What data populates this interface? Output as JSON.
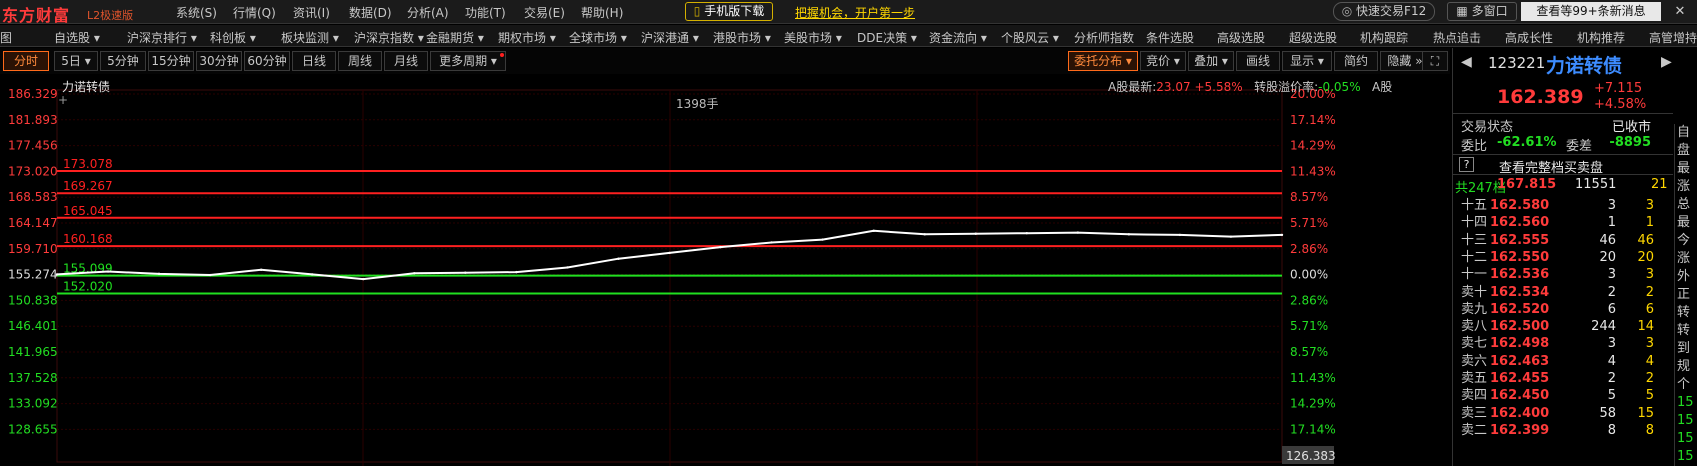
{
  "app": {
    "logo": "东方财富",
    "edition": "L2极速版",
    "menus": [
      "系统(S)",
      "行情(Q)",
      "资讯(I)",
      "数据(D)",
      "分析(A)",
      "功能(T)",
      "交易(E)",
      "帮助(H)"
    ],
    "mobile_download": "手机版下载",
    "promo": "把握机会，开户第一步",
    "fast_trade": "快速交易F12",
    "multi_window": "多窗口",
    "new_messages": "查看等99+条新消息",
    "close_glyph": "✕"
  },
  "nav": [
    "图",
    "自选股 ▾",
    "沪深京排行 ▾",
    "科创板 ▾",
    "板块监测 ▾",
    "沪深京指数 ▾",
    "金融期货 ▾",
    "期权市场 ▾",
    "全球市场 ▾",
    "沪深港通 ▾",
    "港股市场 ▾",
    "美股市场 ▾",
    "DDE决策 ▾",
    "资金流向 ▾",
    "个股风云 ▾",
    "分析师指数",
    "条件选股",
    "高级选股",
    "超级选股",
    "机构跟踪",
    "热点追击",
    "高成长性",
    "机构推荐",
    "高管增持"
  ],
  "periods": [
    "分时",
    "5日 ▾",
    "5分钟",
    "15分钟",
    "30分钟",
    "60分钟",
    "日线",
    "周线",
    "月线",
    "更多周期 ▾"
  ],
  "active_period": "分时",
  "right_tools": [
    "委托分布 ▾",
    "竞价 ▾",
    "叠加 ▾",
    "画线",
    "显示 ▾",
    "简约",
    "隐藏 »",
    "⛶"
  ],
  "chart": {
    "name": "力诺转债",
    "a_share_label": "A股最新:",
    "a_share_price": "23.07",
    "a_share_change": "+5.58%",
    "premium_label": "转股溢价率:",
    "premium": "-0.05%",
    "premium_suffix": "A股",
    "volume_note": "1398手",
    "left_axis": [
      "186.329",
      "181.893",
      "177.456",
      "173.020",
      "168.583",
      "164.147",
      "159.710",
      "155.274",
      "150.838",
      "146.401",
      "141.965",
      "137.528",
      "133.092",
      "128.655"
    ],
    "right_axis": [
      "20.00%",
      "17.14%",
      "14.29%",
      "11.43%",
      "8.57%",
      "5.71%",
      "2.86%",
      "0.00%",
      "2.86%",
      "5.71%",
      "8.57%",
      "11.43%",
      "14.29%",
      "17.14%"
    ],
    "bottom_right_value": "126.383",
    "price_lines": [
      {
        "label": "173.078",
        "color": "#ff2020"
      },
      {
        "label": "169.267",
        "color": "#ff2020"
      },
      {
        "label": "165.045",
        "color": "#ff2020"
      },
      {
        "label": "160.168",
        "color": "#ff2020"
      },
      {
        "label": "155.099",
        "color": "#20e020"
      },
      {
        "label": "152.020",
        "color": "#20e020"
      }
    ],
    "colors": {
      "up": "#ff3b3b",
      "down": "#22dd22",
      "grid": "#2a0000",
      "line": "#ffffff",
      "avg": "#333333"
    }
  },
  "chart_data": {
    "type": "line",
    "title": "力诺转债",
    "x": [
      0,
      10,
      20,
      30,
      40,
      50,
      60,
      70,
      80,
      90,
      100,
      110,
      120,
      130,
      140,
      150,
      160,
      170,
      180,
      190,
      200,
      210,
      220,
      230,
      240
    ],
    "values": [
      155.3,
      155.8,
      155.4,
      155.2,
      156.1,
      155.3,
      154.5,
      155.5,
      155.6,
      155.7,
      156.5,
      158.0,
      159.0,
      160.0,
      160.8,
      161.3,
      162.8,
      162.2,
      162.3,
      162.4,
      162.5,
      162.2,
      162.1,
      161.8,
      162.1
    ],
    "ylim": [
      128.655,
      186.329
    ],
    "grid": true
  },
  "panel": {
    "code": "123221",
    "name": "力诺转债",
    "price": "162.389",
    "change": "+7.115",
    "change_pct": "+4.58%",
    "status_label": "交易状态",
    "status_value": "已收市",
    "webi_label": "委比",
    "webi_value": "-62.61%",
    "weicha_label": "委差",
    "weicha_value": "-8895",
    "view_full": "查看完整档买卖盘",
    "help_glyph": "?",
    "total_label": "共247档",
    "total_price": "167.815",
    "total_vol": "11551",
    "total_num": "21",
    "orderbook": [
      {
        "label": "十五",
        "price": "162.580",
        "vol": "3",
        "num": "3"
      },
      {
        "label": "十四",
        "price": "162.560",
        "vol": "1",
        "num": "1"
      },
      {
        "label": "十三",
        "price": "162.555",
        "vol": "46",
        "num": "46"
      },
      {
        "label": "十二",
        "price": "162.550",
        "vol": "20",
        "num": "20"
      },
      {
        "label": "十一",
        "price": "162.536",
        "vol": "3",
        "num": "3"
      },
      {
        "label": "卖十",
        "price": "162.534",
        "vol": "2",
        "num": "2"
      },
      {
        "label": "卖九",
        "price": "162.520",
        "vol": "6",
        "num": "6"
      },
      {
        "label": "卖八",
        "price": "162.500",
        "vol": "244",
        "num": "14"
      },
      {
        "label": "卖七",
        "price": "162.498",
        "vol": "3",
        "num": "3"
      },
      {
        "label": "卖六",
        "price": "162.463",
        "vol": "4",
        "num": "4"
      },
      {
        "label": "卖五",
        "price": "162.455",
        "vol": "2",
        "num": "2"
      },
      {
        "label": "卖四",
        "price": "162.450",
        "vol": "5",
        "num": "5"
      },
      {
        "label": "卖三",
        "price": "162.400",
        "vol": "58",
        "num": "15"
      },
      {
        "label": "卖二",
        "price": "162.399",
        "vol": "8",
        "num": "8"
      }
    ],
    "side_items": [
      "自",
      "盘",
      "最",
      "涨",
      "总",
      "最",
      "今",
      "涨",
      "外",
      "正",
      "转",
      "转",
      "到",
      "规",
      "个",
      "15",
      "15",
      "15",
      "15",
      "15"
    ]
  }
}
